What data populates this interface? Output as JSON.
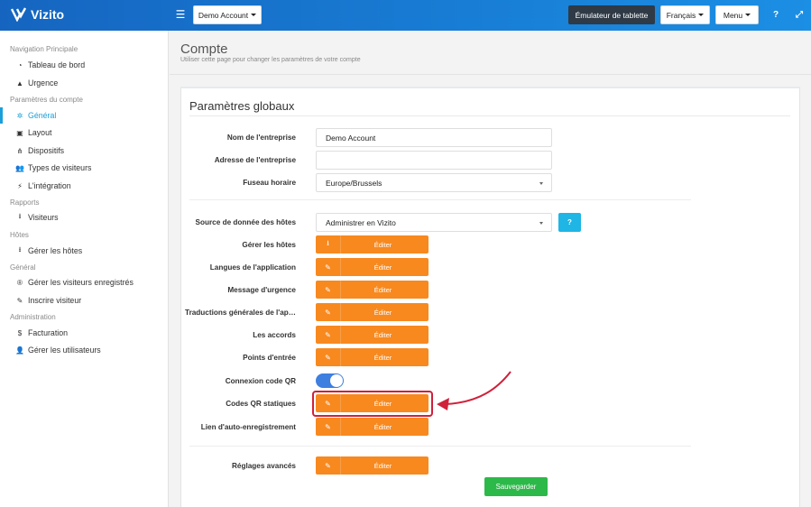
{
  "brand": {
    "name": "Vizito"
  },
  "topbar": {
    "account_label": "Demo Account",
    "emulator_label": "Émulateur de tablette",
    "language_label": "Français",
    "menu_label": "Menu",
    "help_icon": "question-icon",
    "expand_icon": "expand-icon"
  },
  "sidebar": {
    "sections": [
      {
        "title": "Navigation Principale",
        "items": [
          {
            "label": "Tableau de bord",
            "icon": "dashboard-icon"
          },
          {
            "label": "Urgence",
            "icon": "warning-icon"
          }
        ]
      },
      {
        "title": "Paramètres du compte",
        "items": [
          {
            "label": "Général",
            "icon": "gear-icon",
            "active": true
          },
          {
            "label": "Layout",
            "icon": "image-icon"
          },
          {
            "label": "Dispositifs",
            "icon": "sitemap-icon"
          },
          {
            "label": "Types de visiteurs",
            "icon": "users-icon"
          },
          {
            "label": "L'intégration",
            "icon": "plug-icon"
          }
        ]
      },
      {
        "title": "Rapports",
        "items": [
          {
            "label": "Visiteurs",
            "icon": "download-icon"
          }
        ]
      },
      {
        "title": "Hôtes",
        "items": [
          {
            "label": "Gérer les hôtes",
            "icon": "download-icon"
          }
        ]
      },
      {
        "title": "Général",
        "items": [
          {
            "label": "Gérer les visiteurs enregistrés",
            "icon": "registered-icon"
          },
          {
            "label": "Inscrire visiteur",
            "icon": "pencil-icon"
          }
        ]
      },
      {
        "title": "Administration",
        "items": [
          {
            "label": "Facturation",
            "icon": "dollar-icon"
          },
          {
            "label": "Gérer les utilisateurs",
            "icon": "user-plus-icon"
          }
        ]
      }
    ]
  },
  "header": {
    "title": "Compte",
    "subtitle": "Utiliser cette page pour changer les paramètres de votre compte"
  },
  "panel": {
    "title": "Paramètres globaux",
    "company_label": "Nom de l'entreprise",
    "company_value": "Demo Account",
    "address_label": "Adresse de l'entreprise",
    "address_value": "",
    "timezone_label": "Fuseau horaire",
    "timezone_value": "Europe/Brussels",
    "host_source_label": "Source de donnée des hôtes",
    "host_source_value": "Administrer en Vizito",
    "help_label": "?",
    "edit_rows": [
      {
        "label": "Gérer les hôtes",
        "button": "Éditer",
        "icon": "download-icon"
      },
      {
        "label": "Langues de l'application",
        "button": "Éditer",
        "icon": "edit-icon"
      },
      {
        "label": "Message d'urgence",
        "button": "Éditer",
        "icon": "edit-icon"
      },
      {
        "label": "Traductions générales de l'ap…",
        "button": "Éditer",
        "icon": "edit-icon"
      },
      {
        "label": "Les accords",
        "button": "Éditer",
        "icon": "edit-icon"
      },
      {
        "label": "Points d'entrée",
        "button": "Éditer",
        "icon": "edit-icon"
      }
    ],
    "qr_label": "Connexion code QR",
    "qr_enabled": true,
    "static_qr_label": "Codes QR statiques",
    "static_qr_button": "Éditer",
    "self_reg_label": "Lien d'auto-enregistrement",
    "self_reg_button": "Éditer",
    "advanced_label": "Réglages avancés",
    "advanced_button": "Éditer",
    "save_label": "Sauvegarder"
  },
  "colors": {
    "accent": "#1a9fd9",
    "orange": "#f7891f",
    "highlight": "#d0203a",
    "save": "#2db84a"
  }
}
